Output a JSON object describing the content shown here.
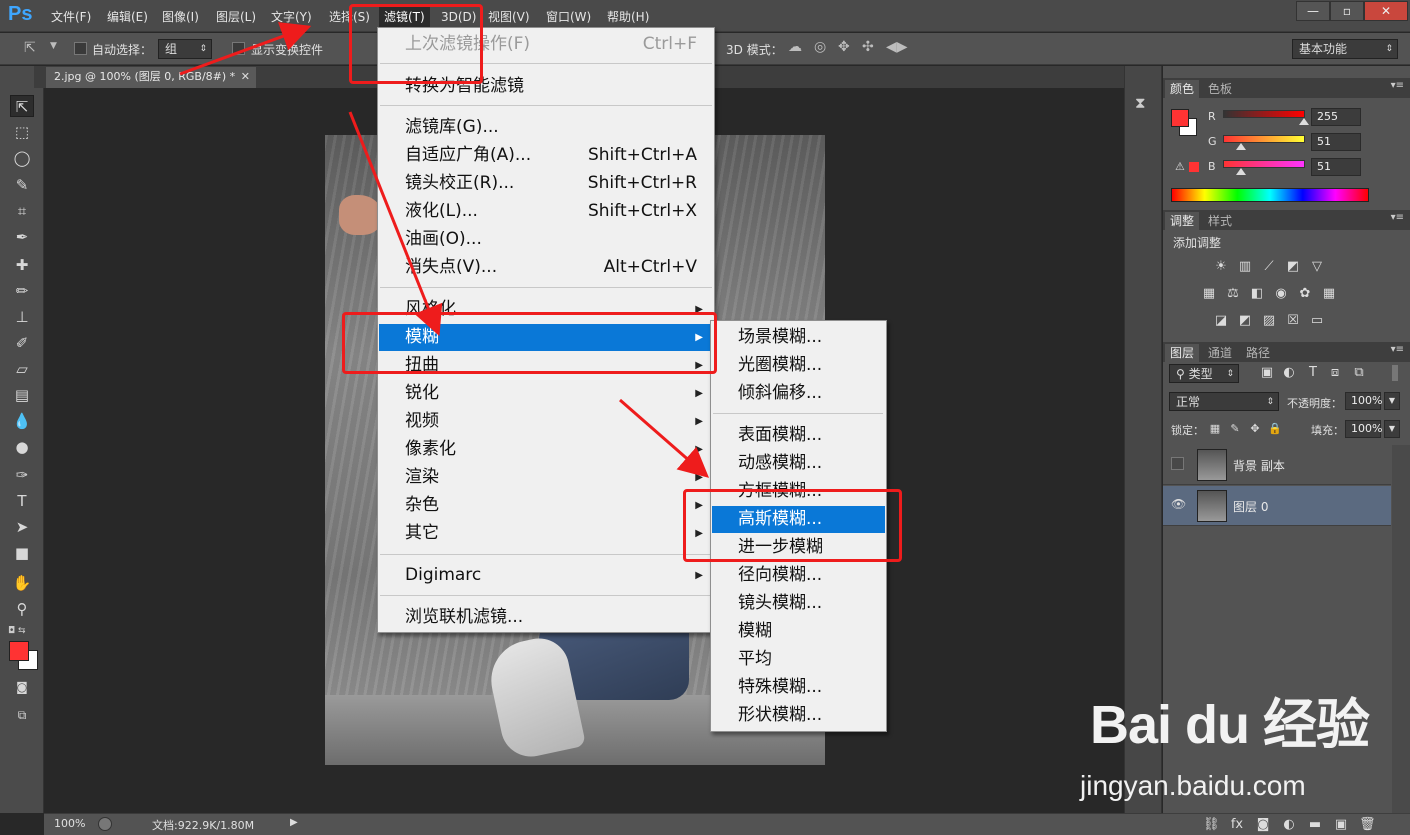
{
  "app": {
    "logo": "Ps"
  },
  "menubar": {
    "items": [
      "文件(F)",
      "编辑(E)",
      "图像(I)",
      "图层(L)",
      "文字(Y)",
      "选择(S)",
      "滤镜(T)",
      "3D(D)",
      "视图(V)",
      "窗口(W)",
      "帮助(H)"
    ],
    "active": "滤镜(T)"
  },
  "window_controls": {
    "minimize": "—",
    "maximize": "▫",
    "close": "✕"
  },
  "options_bar": {
    "auto_select_label": "自动选择：",
    "auto_select_value": "组",
    "show_transform_label": "显示变换控件",
    "mode_3d_label": "3D 模式：",
    "workspace_value": "基本功能"
  },
  "document_tab": {
    "title": "2.jpg @ 100% (图层 0, RGB/8#) *",
    "close": "✕"
  },
  "filter_menu": {
    "items": [
      {
        "label": "上次滤镜操作(F)",
        "shortcut": "Ctrl+F",
        "disabled": true
      },
      {
        "label": "转换为智能滤镜"
      },
      {
        "label": "滤镜库(G)..."
      },
      {
        "label": "自适应广角(A)...",
        "shortcut": "Shift+Ctrl+A"
      },
      {
        "label": "镜头校正(R)...",
        "shortcut": "Shift+Ctrl+R"
      },
      {
        "label": "液化(L)...",
        "shortcut": "Shift+Ctrl+X"
      },
      {
        "label": "油画(O)..."
      },
      {
        "label": "消失点(V)...",
        "shortcut": "Alt+Ctrl+V"
      },
      {
        "label": "风格化",
        "submenu": true
      },
      {
        "label": "模糊",
        "submenu": true,
        "highlighted": true
      },
      {
        "label": "扭曲",
        "submenu": true
      },
      {
        "label": "锐化",
        "submenu": true
      },
      {
        "label": "视频",
        "submenu": true
      },
      {
        "label": "像素化",
        "submenu": true
      },
      {
        "label": "渲染",
        "submenu": true
      },
      {
        "label": "杂色",
        "submenu": true
      },
      {
        "label": "其它",
        "submenu": true
      },
      {
        "label": "Digimarc",
        "submenu": true
      },
      {
        "label": "浏览联机滤镜..."
      }
    ]
  },
  "blur_submenu": {
    "items": [
      {
        "label": "场景模糊..."
      },
      {
        "label": "光圈模糊..."
      },
      {
        "label": "倾斜偏移..."
      },
      {
        "label": "表面模糊..."
      },
      {
        "label": "动感模糊..."
      },
      {
        "label": "方框模糊..."
      },
      {
        "label": "高斯模糊...",
        "highlighted": true
      },
      {
        "label": "进一步模糊"
      },
      {
        "label": "径向模糊..."
      },
      {
        "label": "镜头模糊..."
      },
      {
        "label": "模糊"
      },
      {
        "label": "平均"
      },
      {
        "label": "特殊模糊..."
      },
      {
        "label": "形状模糊..."
      }
    ]
  },
  "color_panel": {
    "tabs": [
      "颜色",
      "色板"
    ],
    "r_label": "R",
    "g_label": "G",
    "b_label": "B",
    "r": "255",
    "g": "51",
    "b": "51",
    "foreground": "#ff3333"
  },
  "adjustments_panel": {
    "tabs": [
      "调整",
      "样式"
    ],
    "title": "添加调整"
  },
  "layers_panel": {
    "tabs": [
      "图层",
      "通道",
      "路径"
    ],
    "filter_kind": "类型",
    "blend_mode": "正常",
    "opacity_label": "不透明度：",
    "opacity_value": "100%",
    "lock_label": "锁定：",
    "fill_label": "填充：",
    "fill_value": "100%",
    "layers": [
      {
        "name": "背景 副本",
        "visible": false
      },
      {
        "name": "图层 0",
        "visible": true,
        "selected": true
      }
    ]
  },
  "status_bar": {
    "zoom": "100%",
    "doc_size": "文档:922.9K/1.80M"
  },
  "watermark": {
    "brand": "Bai du 经验",
    "url": "jingyan.baidu.com"
  },
  "colors": {
    "accent_highlight": "#0a78d7",
    "annotation_red": "#ee1c1c"
  }
}
